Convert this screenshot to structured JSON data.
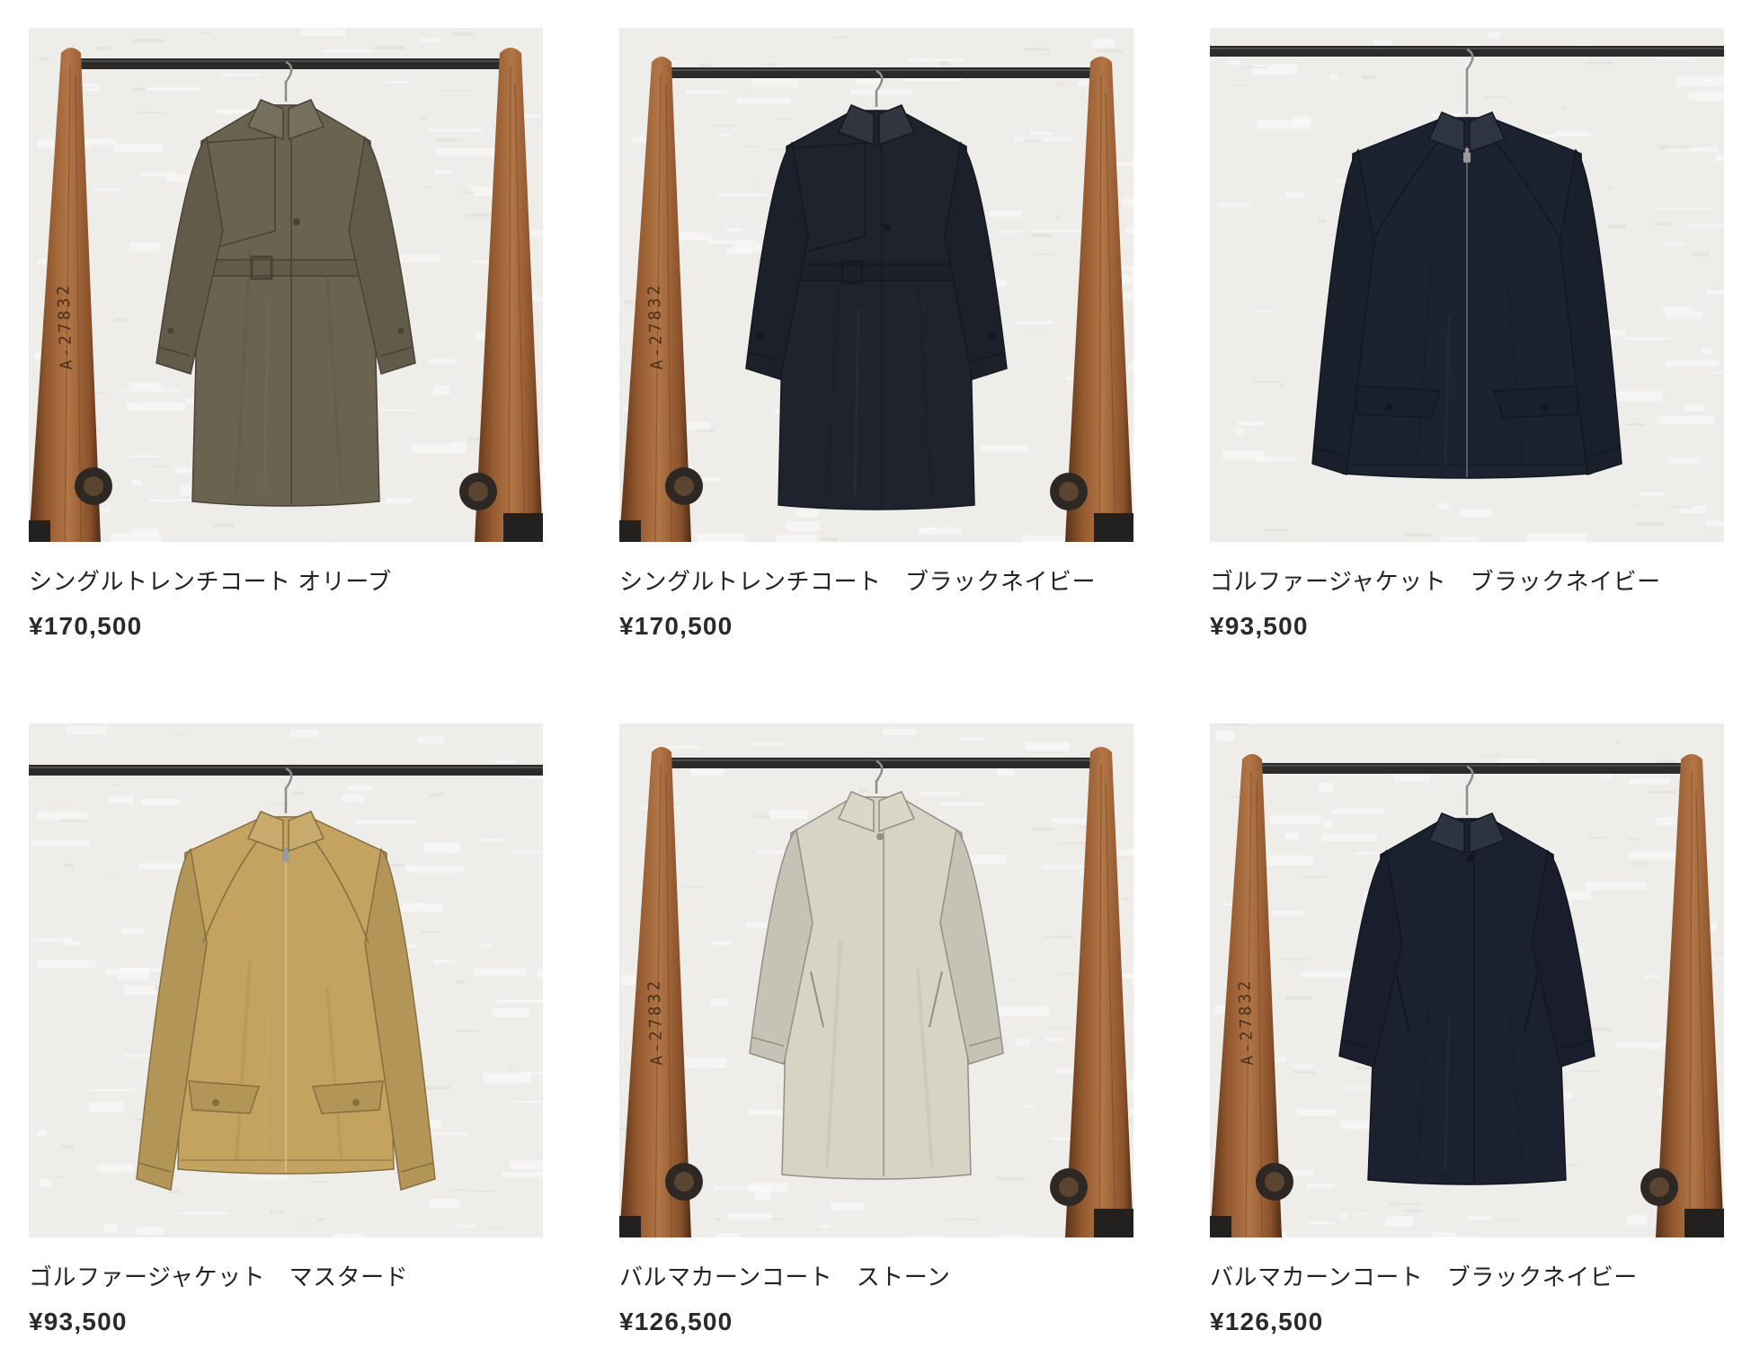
{
  "products": [
    {
      "name": "シングルトレンチコート オリーブ",
      "price": "¥170,500",
      "image": {
        "garment": "trench-coat",
        "color": "#6a6350",
        "rack": "wooden-rack",
        "rack_marking": "A-27832"
      }
    },
    {
      "name": "シングルトレンチコート　ブラックネイビー",
      "price": "¥170,500",
      "image": {
        "garment": "trench-coat",
        "color": "#1e232e",
        "rack": "wooden-rack",
        "rack_marking": "A-27832"
      }
    },
    {
      "name": "ゴルファージャケット　ブラックネイビー",
      "price": "¥93,500",
      "image": {
        "garment": "golfer-jacket",
        "color": "#1c2230",
        "rack": "rail-only"
      }
    },
    {
      "name": "ゴルファージャケット　マスタード",
      "price": "¥93,500",
      "image": {
        "garment": "golfer-jacket",
        "color": "#c3a35f",
        "rack": "rail-only"
      }
    },
    {
      "name": "バルマカーンコート　ストーン",
      "price": "¥126,500",
      "image": {
        "garment": "balmacaan-coat",
        "color": "#d6d4c5",
        "rack": "wooden-rack",
        "rack_marking": "A-27832"
      }
    },
    {
      "name": "バルマカーンコート　ブラックネイビー",
      "price": "¥126,500",
      "image": {
        "garment": "balmacaan-coat",
        "color": "#1c2130",
        "rack": "wooden-rack",
        "rack_marking": "A-27832"
      }
    }
  ],
  "colors": {
    "text": "#222222",
    "wall": "#eeedea",
    "rail": "#2b2b2b",
    "hanger": "#151515",
    "hook": "#8d8d8d"
  }
}
